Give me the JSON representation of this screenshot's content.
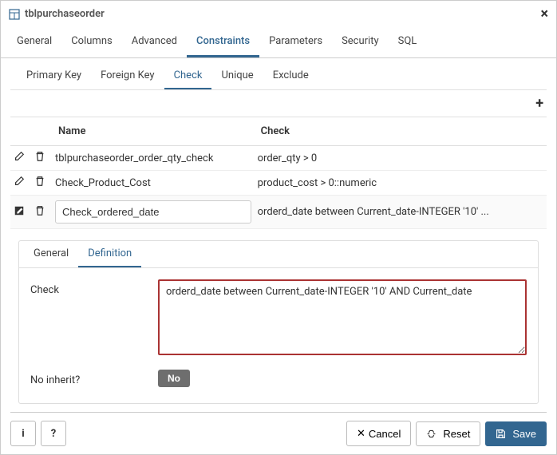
{
  "header": {
    "title": "tblpurchaseorder"
  },
  "main_tabs": {
    "general": "General",
    "columns": "Columns",
    "advanced": "Advanced",
    "constraints": "Constraints",
    "parameters": "Parameters",
    "security": "Security",
    "sql": "SQL"
  },
  "sub_tabs": {
    "primary_key": "Primary Key",
    "foreign_key": "Foreign Key",
    "check": "Check",
    "unique": "Unique",
    "exclude": "Exclude"
  },
  "columns": {
    "name": "Name",
    "check": "Check"
  },
  "rows": [
    {
      "name": "tblpurchaseorder_order_qty_check",
      "check": "order_qty > 0"
    },
    {
      "name": "Check_Product_Cost",
      "check": "product_cost > 0::numeric"
    },
    {
      "name": "Check_ordered_date",
      "check": "orderd_date between Current_date-INTEGER '10' ..."
    }
  ],
  "detail_tabs": {
    "general": "General",
    "definition": "Definition"
  },
  "detail": {
    "check_label": "Check",
    "check_value": "orderd_date between Current_date-INTEGER '10' AND Current_date",
    "no_inherit_label": "No inherit?",
    "no_inherit_toggle": "No"
  },
  "footer": {
    "cancel": "Cancel",
    "reset": "Reset",
    "save": "Save"
  }
}
